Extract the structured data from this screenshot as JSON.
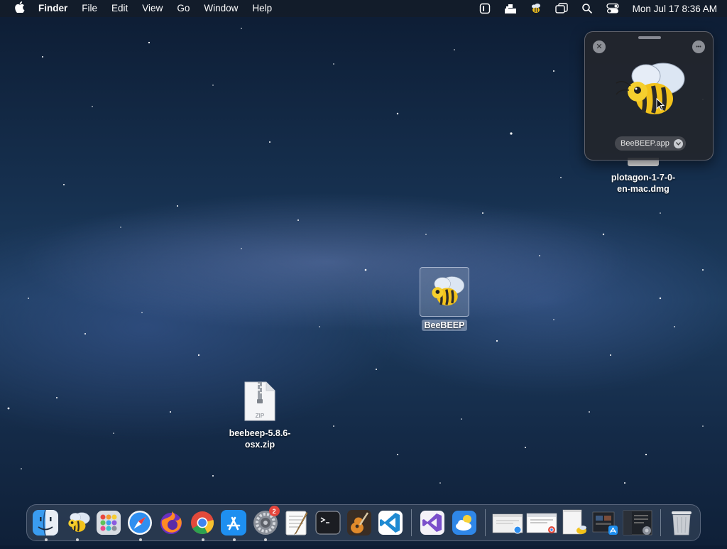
{
  "menubar": {
    "app_name": "Finder",
    "menus": [
      "File",
      "Edit",
      "View",
      "Go",
      "Window",
      "Help"
    ],
    "status_icons": [
      "screen-time-icon",
      "cloud-upload-icon",
      "beebeep-menubar-icon",
      "screen-mirroring-icon",
      "spotlight-search-icon",
      "control-center-icon"
    ],
    "clock": "Mon Jul 17  8:36 AM"
  },
  "desktop": {
    "icons": [
      {
        "name": "plotagon_dmg",
        "label_line1": "plotagon-1-7-0-",
        "label_line2": "en-mac.dmg"
      },
      {
        "name": "beebeep_app",
        "label": "BeeBEEP"
      },
      {
        "name": "beebeep_zip",
        "label_line1": "beebeep-5.8.6-",
        "label_line2": "osx.zip",
        "file_type": "ZIP"
      }
    ]
  },
  "popover": {
    "close_symbol": "✕",
    "more_symbol": "•••",
    "filename": "BeeBEEP.app"
  },
  "dock": {
    "apps": [
      {
        "name": "Finder",
        "icon": "finder-icon",
        "running": true
      },
      {
        "name": "BeeBEEP",
        "icon": "beebeep-icon",
        "running": true
      },
      {
        "name": "Launchpad",
        "icon": "launchpad-icon",
        "running": false
      },
      {
        "name": "Safari",
        "icon": "safari-icon",
        "running": true
      },
      {
        "name": "Firefox",
        "icon": "firefox-icon",
        "running": false
      },
      {
        "name": "Google Chrome",
        "icon": "chrome-icon",
        "running": true
      },
      {
        "name": "App Store",
        "icon": "app-store-icon",
        "running": true
      },
      {
        "name": "System Settings",
        "icon": "system-settings-icon",
        "running": true,
        "badge": "2"
      },
      {
        "name": "TextEdit",
        "icon": "textedit-icon",
        "running": false
      },
      {
        "name": "Terminal",
        "icon": "terminal-icon",
        "running": false
      },
      {
        "name": "GarageBand",
        "icon": "garageband-icon",
        "running": false
      },
      {
        "name": "Visual Studio Code",
        "icon": "vscode-icon",
        "running": false
      },
      {
        "name": "Visual Studio",
        "icon": "visual-studio-icon",
        "running": false
      },
      {
        "name": "Weather",
        "icon": "weather-icon",
        "running": false
      }
    ],
    "windows": [
      "safari-window-thumb",
      "chrome-window-thumb",
      "beebeep-window-thumb",
      "app-store-window-thumb",
      "settings-window-thumb"
    ],
    "trash": "trash-icon"
  },
  "colors": {
    "menubar_bg": "#141c28",
    "badge_red": "#e5463d",
    "popover_bg": "#23262d",
    "bee_yellow": "#f2c21b"
  }
}
